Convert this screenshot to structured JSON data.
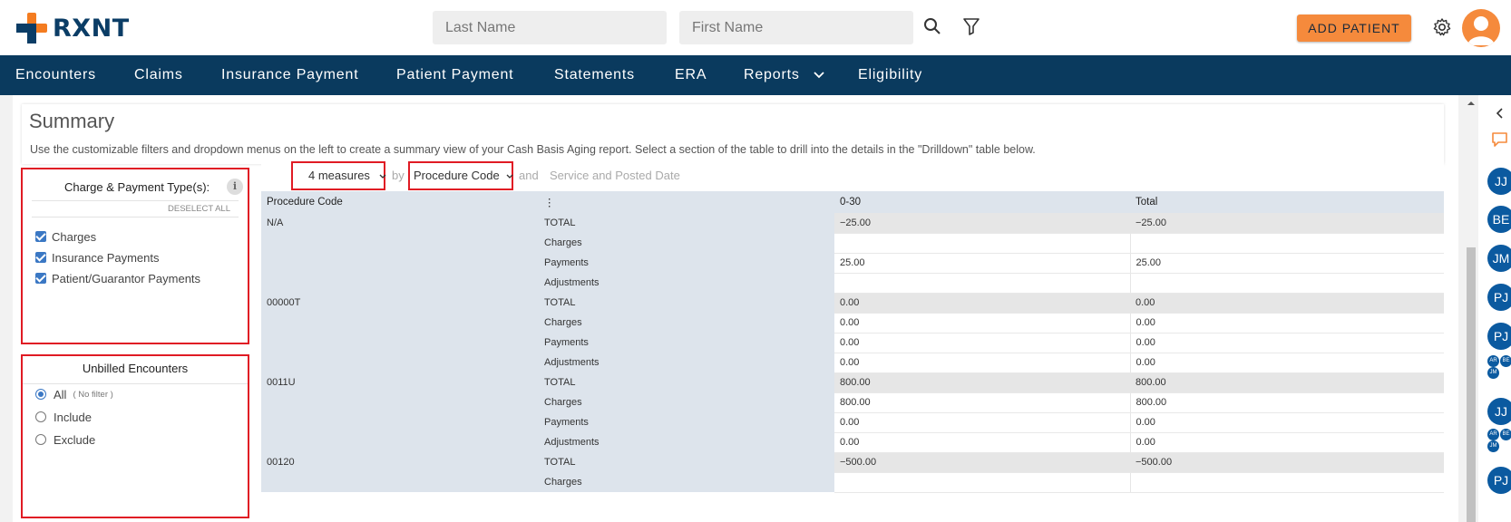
{
  "brand": {
    "name": "RXNT",
    "orange": "#f47c20",
    "navy": "#0b3d66"
  },
  "header": {
    "last_name_placeholder": "Last Name",
    "first_name_placeholder": "First Name",
    "add_patient_label": "ADD PATIENT",
    "icons": [
      "search-icon",
      "filter-icon",
      "gear-icon",
      "user-avatar"
    ]
  },
  "nav": {
    "items": [
      "Encounters",
      "Claims",
      "Insurance Payment",
      "Patient Payment",
      "Statements",
      "ERA",
      "Reports",
      "Eligibility"
    ],
    "reports_has_dropdown": true
  },
  "summary": {
    "title": "Summary",
    "description": "Use the customizable filters and dropdown menus on the left to create a summary view of your Cash Basis Aging report. Select a section of the table to drill into the details in the \"Drilldown\" table below."
  },
  "charge_panel": {
    "title": "Charge & Payment Type(s):",
    "info": "i",
    "deselect_label": "DESELECT ALL",
    "options": [
      {
        "label": "Charges",
        "checked": true
      },
      {
        "label": "Insurance Payments",
        "checked": true
      },
      {
        "label": "Patient/Guarantor Payments",
        "checked": true
      }
    ]
  },
  "unbilled_panel": {
    "title": "Unbilled Encounters",
    "options": [
      {
        "label": "All",
        "note": "( No filter )",
        "selected": true
      },
      {
        "label": "Include",
        "note": "",
        "selected": false
      },
      {
        "label": "Exclude",
        "note": "",
        "selected": false
      }
    ]
  },
  "report": {
    "measures_label": "4 measures",
    "by_label": "by",
    "group_label": "Procedure Code",
    "and_label": "and",
    "secondary_label": "Service and Posted Date",
    "menu_icon": "⋮",
    "columns": [
      "Procedure Code",
      "",
      "0-30",
      "Total"
    ],
    "rows": [
      {
        "code": "N/A",
        "measure": "TOTAL",
        "c1": "−25.00",
        "total": "−25.00",
        "is_total": true
      },
      {
        "code": "",
        "measure": "Charges",
        "c1": "",
        "total": "",
        "is_total": false
      },
      {
        "code": "",
        "measure": "Payments",
        "c1": "25.00",
        "total": "25.00",
        "is_total": false
      },
      {
        "code": "",
        "measure": "Adjustments",
        "c1": "",
        "total": "",
        "is_total": false
      },
      {
        "code": "00000T",
        "measure": "TOTAL",
        "c1": "0.00",
        "total": "0.00",
        "is_total": true
      },
      {
        "code": "",
        "measure": "Charges",
        "c1": "0.00",
        "total": "0.00",
        "is_total": false
      },
      {
        "code": "",
        "measure": "Payments",
        "c1": "0.00",
        "total": "0.00",
        "is_total": false
      },
      {
        "code": "",
        "measure": "Adjustments",
        "c1": "0.00",
        "total": "0.00",
        "is_total": false
      },
      {
        "code": "0011U",
        "measure": "TOTAL",
        "c1": "800.00",
        "total": "800.00",
        "is_total": true
      },
      {
        "code": "",
        "measure": "Charges",
        "c1": "800.00",
        "total": "800.00",
        "is_total": false
      },
      {
        "code": "",
        "measure": "Payments",
        "c1": "0.00",
        "total": "0.00",
        "is_total": false
      },
      {
        "code": "",
        "measure": "Adjustments",
        "c1": "0.00",
        "total": "0.00",
        "is_total": false
      },
      {
        "code": "00120",
        "measure": "TOTAL",
        "c1": "−500.00",
        "total": "−500.00",
        "is_total": true
      },
      {
        "code": "",
        "measure": "Charges",
        "c1": "",
        "total": "",
        "is_total": false
      }
    ]
  },
  "right_rail": {
    "chips": [
      "JJ",
      "BE",
      "JM",
      "PJ",
      "PJ",
      "JJ",
      "PJ"
    ],
    "mini_group_1": [
      "AR",
      "BE",
      "JM"
    ],
    "mini_group_2": [
      "AR",
      "BE",
      "JM"
    ]
  }
}
